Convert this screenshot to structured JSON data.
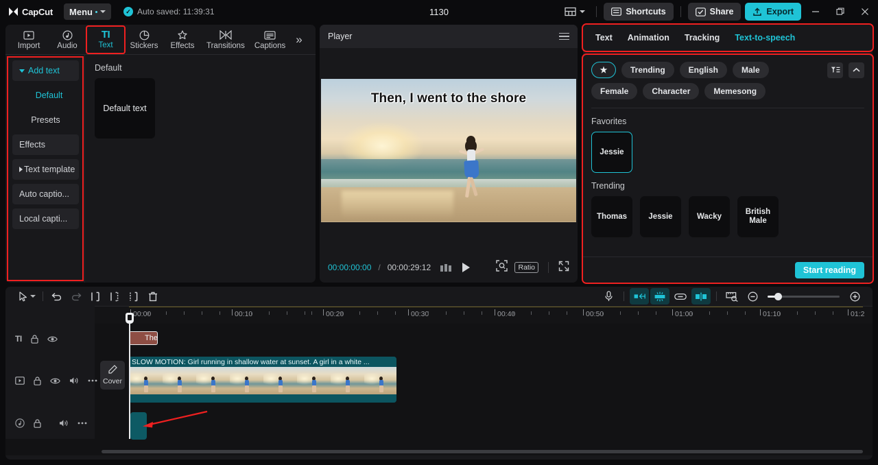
{
  "titlebar": {
    "brand": "CapCut",
    "menu_label": "Menu",
    "autosave": "Auto saved: 11:39:31",
    "project_title": "1130",
    "shortcuts_label": "Shortcuts",
    "share_label": "Share",
    "export_label": "Export",
    "layout_icon": "layout-icon",
    "minimize_icon": "minimize-icon",
    "maximize_icon": "maximize-icon",
    "close_icon": "close-icon",
    "accent": "#1fc3d6"
  },
  "left_panel": {
    "tabs": [
      {
        "label": "Import",
        "icon": "import-icon",
        "active": false
      },
      {
        "label": "Audio",
        "icon": "audio-note-icon",
        "active": false
      },
      {
        "label": "Text",
        "icon": "text-ti-icon",
        "active": true
      },
      {
        "label": "Stickers",
        "icon": "sticker-icon",
        "active": false
      },
      {
        "label": "Effects",
        "icon": "effects-sparkle-icon",
        "active": false
      },
      {
        "label": "Transitions",
        "icon": "transitions-icon",
        "active": false
      },
      {
        "label": "Captions",
        "icon": "captions-icon",
        "active": false
      }
    ],
    "more_label": "»",
    "nav": [
      {
        "label": "Add text",
        "type": "header"
      },
      {
        "label": "Default",
        "type": "selected"
      },
      {
        "label": "Presets",
        "type": "plain"
      },
      {
        "label": "Effects",
        "type": "item"
      },
      {
        "label": "Text template",
        "type": "collapsed"
      },
      {
        "label": "Auto captio...",
        "type": "item"
      },
      {
        "label": "Local capti...",
        "type": "item"
      }
    ],
    "section_label": "Default",
    "preset_label": "Default text"
  },
  "player": {
    "title": "Player",
    "menu_icon": "hamburger-icon",
    "caption_overlay": "Then, I went to the shore",
    "current_time": "00:00:00:00",
    "separator": "/",
    "total_time": "00:00:29:12",
    "quality_icon": "quality-bars-icon",
    "play_icon": "play-icon",
    "crop_icon": "focus-crop-icon",
    "ratio_label": "Ratio",
    "fullscreen_icon": "fullscreen-icon"
  },
  "right_panel": {
    "tabs": [
      {
        "label": "Text",
        "active": false
      },
      {
        "label": "Animation",
        "active": false
      },
      {
        "label": "Tracking",
        "active": false
      },
      {
        "label": "Text-to-speech",
        "active": true
      }
    ],
    "filter_chips_row1": [
      {
        "label": "★",
        "type": "star"
      },
      {
        "label": "Trending",
        "type": "chip"
      },
      {
        "label": "English",
        "type": "chip"
      },
      {
        "label": "Male",
        "type": "chip"
      }
    ],
    "filter_chips_row2": [
      {
        "label": "Female",
        "type": "chip"
      },
      {
        "label": "Character",
        "type": "chip"
      },
      {
        "label": "Memesong",
        "type": "chip"
      }
    ],
    "filter_icon": "filter-list-icon",
    "collapse_icon": "chevron-up-icon",
    "favorites_label": "Favorites",
    "favorites": [
      {
        "label": "Jessie",
        "selected": true
      }
    ],
    "trending_label": "Trending",
    "trending": [
      {
        "label": "Thomas",
        "selected": false
      },
      {
        "label": "Jessie",
        "selected": false
      },
      {
        "label": "Wacky",
        "selected": false
      },
      {
        "label": "British Male",
        "selected": false
      }
    ],
    "start_button": "Start reading"
  },
  "timeline": {
    "toolbar": {
      "select_icon": "cursor-select-icon",
      "dropdown_icon": "chevron-down-icon",
      "undo_icon": "undo-icon",
      "redo_icon": "redo-icon",
      "split_icon": "split-icon",
      "trim_left_icon": "trim-left-icon",
      "trim_right_icon": "trim-right-icon",
      "delete_icon": "delete-icon",
      "mic_icon": "microphone-icon",
      "mirror_icon": "mirror-icon",
      "freeze_icon": "freeze-icon",
      "link_icon": "link-icon",
      "align_icon": "align-icon",
      "preview_icon": "preview-ruler-icon",
      "zoom_out_icon": "zoom-out-icon",
      "zoom_in_icon": "zoom-in-icon",
      "zoom_slider": "zoom-slider"
    },
    "ruler_ticks": [
      "00:00",
      "00:10",
      "00:20",
      "00:30",
      "00:40",
      "00:50",
      "01:00",
      "01:10",
      "01:2"
    ],
    "tracks": [
      {
        "type": "text",
        "head_icons": [
          "text-ti-icon",
          "lock-icon",
          "eye-icon"
        ],
        "clip_label": "The"
      },
      {
        "type": "video",
        "head_icons": [
          "video-icon",
          "lock-icon",
          "eye-icon",
          "volume-icon",
          "more-icon"
        ],
        "cover_label": "Cover",
        "cover_icon": "pencil-icon",
        "clip_label": "SLOW MOTION: Girl running in shallow water at sunset. A girl in a white ..."
      },
      {
        "type": "audio",
        "head_icons": [
          "audio-note-icon",
          "lock-icon",
          "volume-icon",
          "more-icon"
        ],
        "clip_label": ""
      }
    ],
    "playhead_time": "00:00",
    "annotation_arrow": "red-arrow-annotation"
  }
}
